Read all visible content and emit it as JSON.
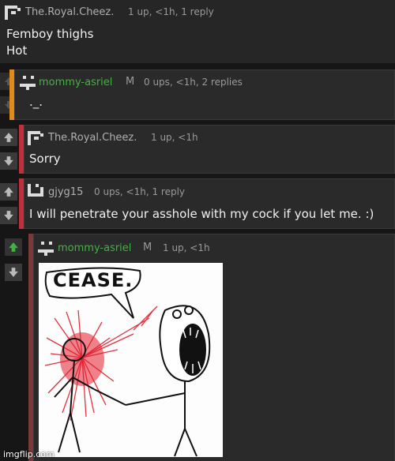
{
  "comments": [
    {
      "username": "The.Royal.Cheez.",
      "meta": "1 up, <1h, 1 reply",
      "lines": [
        "Femboy thighs",
        "Hot"
      ],
      "username_color": "#b0b0b0"
    },
    {
      "username": "mommy-asriel",
      "mod_badge": "M",
      "meta": "0 ups, <1h, 2 replies",
      "lines": [
        "._."
      ],
      "username_color": "#3fb53f",
      "bar_color": "#e08a1e"
    },
    {
      "username": "The.Royal.Cheez.",
      "meta": "1 up, <1h",
      "lines": [
        "Sorry"
      ],
      "bar_color": "#c0303a"
    },
    {
      "username": "gjyg15",
      "meta": "0 ups, <1h, 1 reply",
      "lines": [
        "I will penetrate your asshole with my cock if you let me. :)"
      ],
      "bar_color": "#c0303a"
    },
    {
      "username": "mommy-asriel",
      "mod_badge": "M",
      "meta": "1 up, <1h",
      "image_text": "CEASE.",
      "upvote_active_color": "#3fb53f",
      "bar_color": "#7a3a3a"
    }
  ],
  "watermark": "imgflip.com",
  "colors": {
    "background": "#161616",
    "panel": "#2a2a2a",
    "mod_green": "#3fb53f"
  },
  "icons": [
    "upvote-arrow-icon",
    "downvote-arrow-icon",
    "avatar-icon"
  ]
}
